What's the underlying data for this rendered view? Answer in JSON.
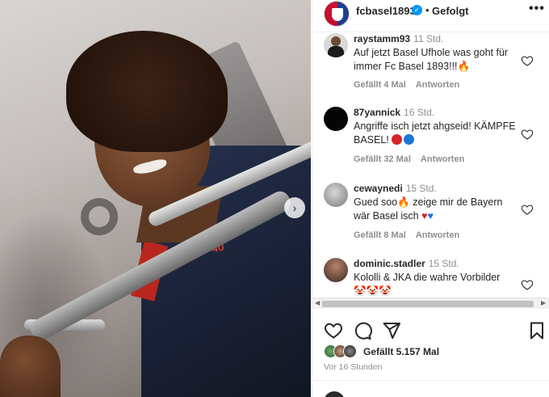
{
  "post": {
    "handle": "fcbasel1893",
    "follow_status": "Gefolgt",
    "dot": "•",
    "more_icon": "more-horizontal-icon",
    "next_icon": "chevron-right-icon",
    "jersey_number": "40",
    "likes": "Gefällt 5.157 Mal",
    "posted": "Vor 16 Stunden"
  },
  "comments": [
    {
      "user": "raystamm93",
      "time": "11 Std.",
      "text": "Auf jetzt Basel Ufhole was goht für immer Fc Basel 1893!!!",
      "text_emoji": "🔥",
      "likes": "Gefällt 4 Mal",
      "reply": "Antworten"
    },
    {
      "user": "87yannick",
      "time": "16 Std.",
      "text": "Angriffe isch jetzt ahgseid! KÄMPFE BASEL!",
      "likes": "Gefällt 32 Mal",
      "reply": "Antworten"
    },
    {
      "user": "cewaynedi",
      "time": "15 Std.",
      "text_a": "Gued soo",
      "text_emoji": "🔥",
      "text_b": " zeige mir de Bayern wär Basel isch",
      "likes": "Gefällt 8 Mal",
      "reply": "Antworten"
    },
    {
      "user": "dominic.stadler",
      "time": "15 Std.",
      "text": "Kololli & JKA die wahre Vorbilder",
      "text_emoji": "🤡🤡🤡"
    }
  ],
  "colors": {
    "brand_blue": "#1e3e8f",
    "brand_red": "#c8102e",
    "verified": "#0095f6",
    "muted": "#8e8e8e"
  }
}
